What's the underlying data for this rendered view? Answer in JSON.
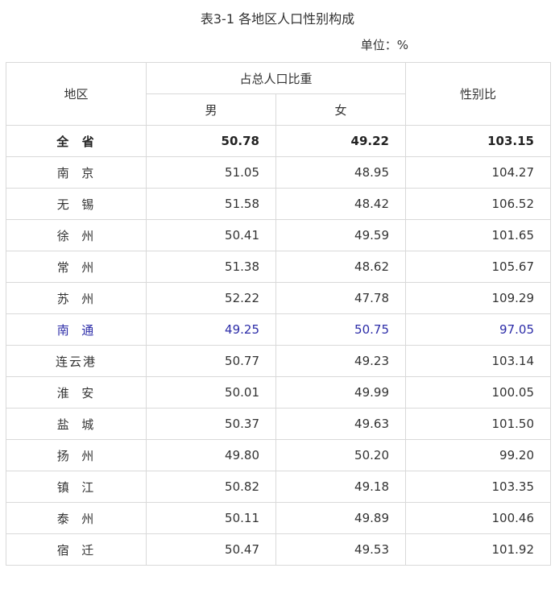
{
  "title": "表3-1 各地区人口性别构成",
  "unit": "单位：%",
  "headers": {
    "region": "地区",
    "share": "占总人口比重",
    "male": "男",
    "female": "女",
    "ratio": "性别比"
  },
  "colors": {
    "border": "#d9d9d9",
    "highlight_text": "#2c2ca8",
    "text": "#333333"
  },
  "rows": [
    {
      "region": "全  省",
      "male": "50.78",
      "female": "49.22",
      "ratio": "103.15",
      "bold": true
    },
    {
      "region": "南  京",
      "male": "51.05",
      "female": "48.95",
      "ratio": "104.27"
    },
    {
      "region": "无  锡",
      "male": "51.58",
      "female": "48.42",
      "ratio": "106.52"
    },
    {
      "region": "徐  州",
      "male": "50.41",
      "female": "49.59",
      "ratio": "101.65"
    },
    {
      "region": "常  州",
      "male": "51.38",
      "female": "48.62",
      "ratio": "105.67"
    },
    {
      "region": "苏  州",
      "male": "52.22",
      "female": "47.78",
      "ratio": "109.29"
    },
    {
      "region": "南  通",
      "male": "49.25",
      "female": "50.75",
      "ratio": "97.05",
      "highlight": true
    },
    {
      "region": "连云港",
      "male": "50.77",
      "female": "49.23",
      "ratio": "103.14"
    },
    {
      "region": "淮  安",
      "male": "50.01",
      "female": "49.99",
      "ratio": "100.05"
    },
    {
      "region": "盐  城",
      "male": "50.37",
      "female": "49.63",
      "ratio": "101.50"
    },
    {
      "region": "扬  州",
      "male": "49.80",
      "female": "50.20",
      "ratio": "99.20"
    },
    {
      "region": "镇  江",
      "male": "50.82",
      "female": "49.18",
      "ratio": "103.35"
    },
    {
      "region": "泰  州",
      "male": "50.11",
      "female": "49.89",
      "ratio": "100.46"
    },
    {
      "region": "宿  迁",
      "male": "50.47",
      "female": "49.53",
      "ratio": "101.92"
    }
  ]
}
